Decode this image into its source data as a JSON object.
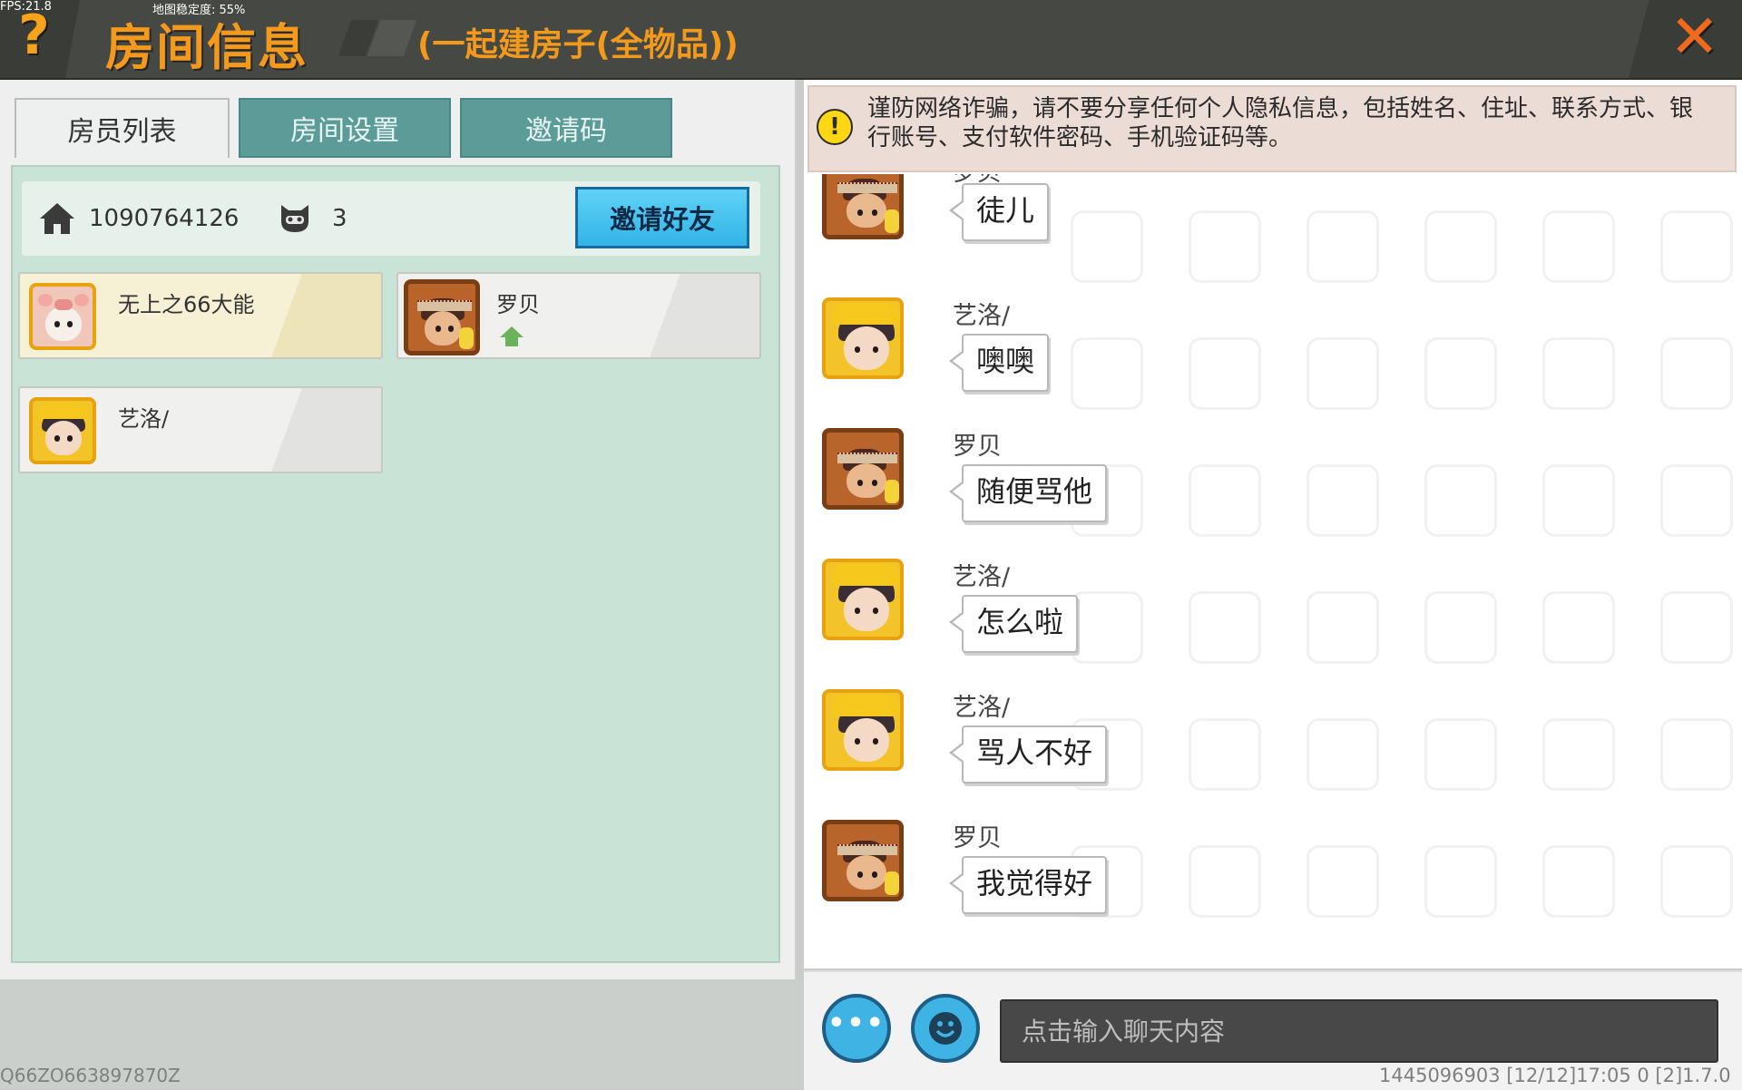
{
  "debug": {
    "fps": "FPS:21.8",
    "stability": "地图稳定度: 55%"
  },
  "header": {
    "help_label": "?",
    "title": "房间信息",
    "subtitle": "(一起建房子(全物品))",
    "close_label": "✕"
  },
  "tabs": [
    {
      "label": "房员列表",
      "active": true
    },
    {
      "label": "房间设置",
      "active": false
    },
    {
      "label": "邀请码",
      "active": false
    }
  ],
  "room": {
    "id": "1090764126",
    "player_count": "3",
    "invite_label": "邀请好友",
    "home_icon": "house-icon",
    "players_icon": "cat-icon"
  },
  "members": [
    {
      "name": "无上之66大能",
      "avatar": "pig-avatar",
      "host": false
    },
    {
      "name": "罗贝",
      "avatar": "adventurer-avatar",
      "host": true,
      "host_icon": "house-arrow-icon"
    },
    {
      "name": "艺洛/",
      "avatar": "yellow-hat-avatar",
      "host": false
    }
  ],
  "notice": {
    "icon": "warning-icon",
    "text": "谨防网络诈骗，请不要分享任何个人隐私信息，包括姓名、住址、联系方式、银行账号、支付软件密码、手机验证码等。"
  },
  "messages": [
    {
      "sender": "罗贝",
      "text": "徒儿",
      "avatar": "adventurer-avatar"
    },
    {
      "sender": "艺洛/",
      "text": "噢噢",
      "avatar": "yellow-hat-avatar"
    },
    {
      "sender": "罗贝",
      "text": "随便骂他",
      "avatar": "adventurer-avatar"
    },
    {
      "sender": "艺洛/",
      "text": "怎么啦",
      "avatar": "yellow-hat-avatar"
    },
    {
      "sender": "艺洛/",
      "text": "骂人不好",
      "avatar": "yellow-hat-avatar"
    },
    {
      "sender": "罗贝",
      "text": "我觉得好",
      "avatar": "adventurer-avatar"
    }
  ],
  "input": {
    "placeholder": "点击输入聊天内容",
    "more_label": "•••",
    "more_icon": "ellipsis-icon",
    "emoji_icon": "smiley-icon"
  },
  "footer": {
    "left": "Q66ZO663897870Z",
    "right": "1445096903   [12/12]17:05 0   [2]1.7.0"
  },
  "colors": {
    "accent_orange": "#f39a1d",
    "tab_teal": "#5c9c98",
    "invite_blue": "#33b4e8",
    "panel_green": "#c9e4d6"
  }
}
